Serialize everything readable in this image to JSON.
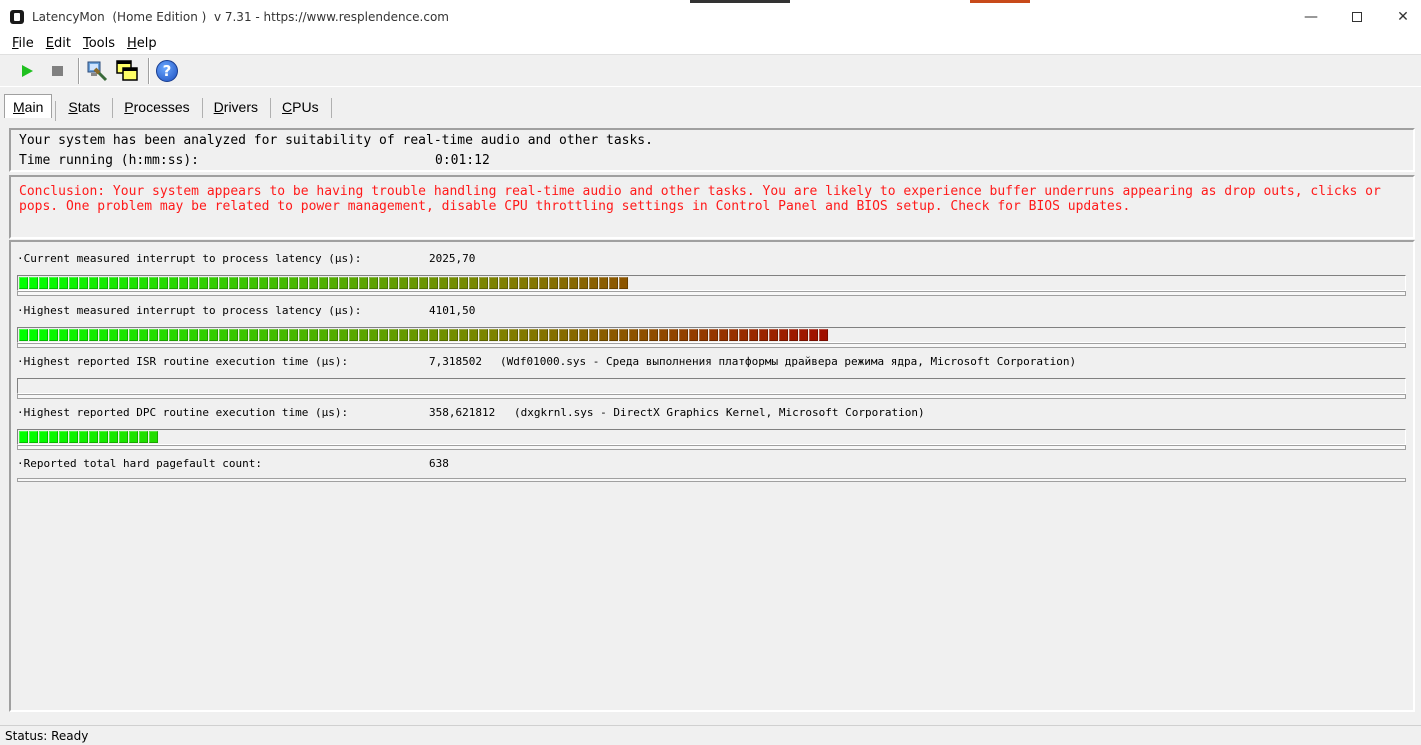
{
  "window": {
    "title": "LatencyMon  (Home Edition )  v 7.31 - https://www.resplendence.com",
    "controls": {
      "minimize": "—",
      "close": "✕"
    }
  },
  "menu": [
    {
      "u": "F",
      "rest": "ile"
    },
    {
      "u": "E",
      "rest": "dit"
    },
    {
      "u": "T",
      "rest": "ools"
    },
    {
      "u": "H",
      "rest": "elp"
    }
  ],
  "toolbar": {
    "icons": [
      "start-icon",
      "stop-icon",
      "hardware-icon",
      "copy-windows-icon",
      "help-icon"
    ],
    "help_glyph": "?"
  },
  "tabs": [
    {
      "u": "M",
      "rest": "ain"
    },
    {
      "u": "S",
      "rest": "tats"
    },
    {
      "u": "P",
      "rest": "rocesses"
    },
    {
      "u": "D",
      "rest": "rivers"
    },
    {
      "u": "C",
      "rest": "PUs"
    }
  ],
  "summary": {
    "line1": "Your system has been analyzed for suitability of real-time audio and other tasks.",
    "time_label": "Time running (h:mm:ss):",
    "time_value": "0:01:12"
  },
  "conclusion": "Conclusion: Your system appears to be having trouble handling real-time audio and other tasks. You are likely to experience buffer underruns appearing as drop outs, clicks or pops. One problem may be related to power management, disable CPU throttling settings in Control Panel and BIOS setup. Check for BIOS updates.",
  "metrics": [
    {
      "label": "·Current measured interrupt to process latency (µs):",
      "value": "2025,70",
      "extra": "",
      "bar_segments": 61
    },
    {
      "label": "·Highest measured interrupt to process latency (µs):",
      "value": "4101,50",
      "extra": "",
      "bar_segments": 81
    },
    {
      "label": "·Highest reported ISR routine execution time (µs):",
      "value": "7,318502",
      "extra": "(Wdf01000.sys - Среда выполнения платформы драйвера режима ядра, Microsoft Corporation)",
      "bar_segments": 0
    },
    {
      "label": "·Highest reported DPC routine execution time (µs):",
      "value": "358,621812",
      "extra": "(dxgkrnl.sys - DirectX Graphics Kernel, Microsoft Corporation)",
      "bar_segments": 14
    },
    {
      "label": "·Reported total hard pagefault count:",
      "value": "638",
      "extra": ""
    }
  ],
  "bar_colors": {
    "start": "#00ff00",
    "mid": "#808000",
    "end": "#a01000"
  },
  "conclusion_color": "#ff1a1a",
  "status": "Status: Ready"
}
